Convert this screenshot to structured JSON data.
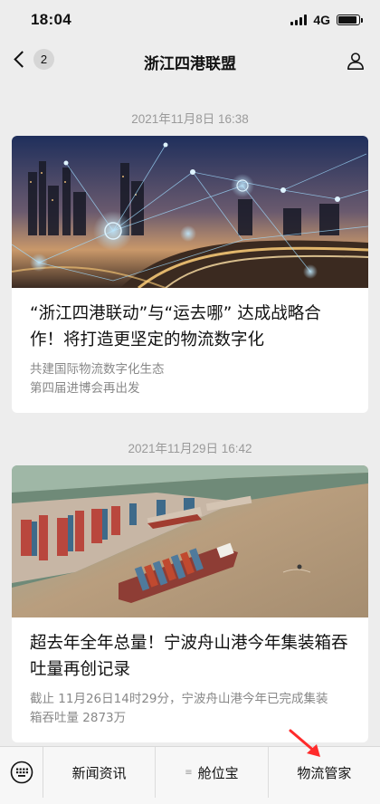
{
  "status_bar": {
    "time": "18:04",
    "network": "4G",
    "battery_level": 0.9
  },
  "nav": {
    "title": "浙江四港联盟",
    "back_count": "2",
    "back_icon": "chevron-left-icon",
    "profile_icon": "person-icon"
  },
  "feed": [
    {
      "timestamp": "2021年11月8日 16:38",
      "title": "“浙江四港联动”与“运去哪” 达成战略合作！将打造更坚定的物流数字化",
      "desc_lines": [
        "共建国际物流数字化生态",
        "第四届进博会再出发"
      ]
    },
    {
      "timestamp": "2021年11月29日 16:42",
      "title": "超去年全年总量！宁波舟山港今年集装箱吞吐量再创记录",
      "desc_lines": [
        "截止 11月26日14时29分，宁波舟山港今年已完成集装",
        "箱吞吐量 2873万"
      ]
    }
  ],
  "menu": {
    "keyboard_icon": "keyboard-icon",
    "items": [
      {
        "label": "新闻资讯"
      },
      {
        "label": "舱位宝",
        "has_submenu": true
      },
      {
        "label": "物流管家"
      }
    ]
  },
  "annotation": {
    "color": "#ff2b2b"
  }
}
